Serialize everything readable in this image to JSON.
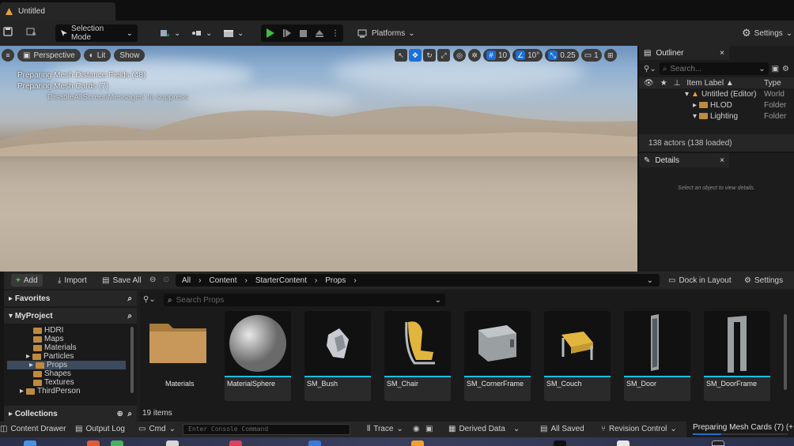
{
  "window": {
    "title": "Untitled"
  },
  "toolbar": {
    "selection_mode": "Selection Mode",
    "platforms": "Platforms",
    "settings": "Settings"
  },
  "viewport": {
    "perspective": "Perspective",
    "lit": "Lit",
    "show": "Show",
    "grid_snap": "10",
    "rotation_snap": "10°",
    "scale_snap": "0.25",
    "camera_speed": "1",
    "messages": [
      "Preparing Mesh Distance Fields (48)",
      "Preparing Mesh Cards (7)",
      "'DisableAllScreenMessages' to suppress"
    ]
  },
  "outliner": {
    "tab": "Outliner",
    "search_placeholder": "Search...",
    "col_label": "Item Label ▲",
    "col_type": "Type",
    "rows": [
      {
        "label": "Untitled (Editor)",
        "type": "World"
      },
      {
        "label": "HLOD",
        "type": "Folder"
      },
      {
        "label": "Lighting",
        "type": "Folder"
      }
    ],
    "actors": "138 actors (138 loaded)"
  },
  "details": {
    "tab": "Details",
    "empty": "Select an object to view details."
  },
  "content_browser": {
    "add": "Add",
    "import": "Import",
    "save_all": "Save All",
    "path": [
      "All",
      "Content",
      "StarterContent",
      "Props"
    ],
    "dock": "Dock in Layout",
    "settings": "Settings",
    "favorites": "Favorites",
    "project": "MyProject",
    "tree": [
      "HDRI",
      "Maps",
      "Materials",
      "Particles",
      "Props",
      "Shapes",
      "Textures",
      "ThirdPerson"
    ],
    "collections": "Collections",
    "search_placeholder": "Search Props",
    "items": [
      "Materials",
      "MaterialSphere",
      "SM_Bush",
      "SM_Chair",
      "SM_CornerFrame",
      "SM_Couch",
      "SM_Door",
      "SM_DoorFrame"
    ],
    "count": "19 items"
  },
  "statusbar": {
    "content_drawer": "Content Drawer",
    "output_log": "Output Log",
    "cmd": "Cmd",
    "console_placeholder": "Enter Console Command",
    "trace": "Trace",
    "derived_data": "Derived Data",
    "all_saved": "All Saved",
    "revision_control": "Revision Control",
    "progress": "Preparing Mesh Cards (7) (+1"
  },
  "colors": {
    "accent_blue": "#1d6fd6",
    "play_green": "#3fbf3f",
    "asset_cyan": "#19c0e0",
    "folder": "#c08a3e"
  }
}
